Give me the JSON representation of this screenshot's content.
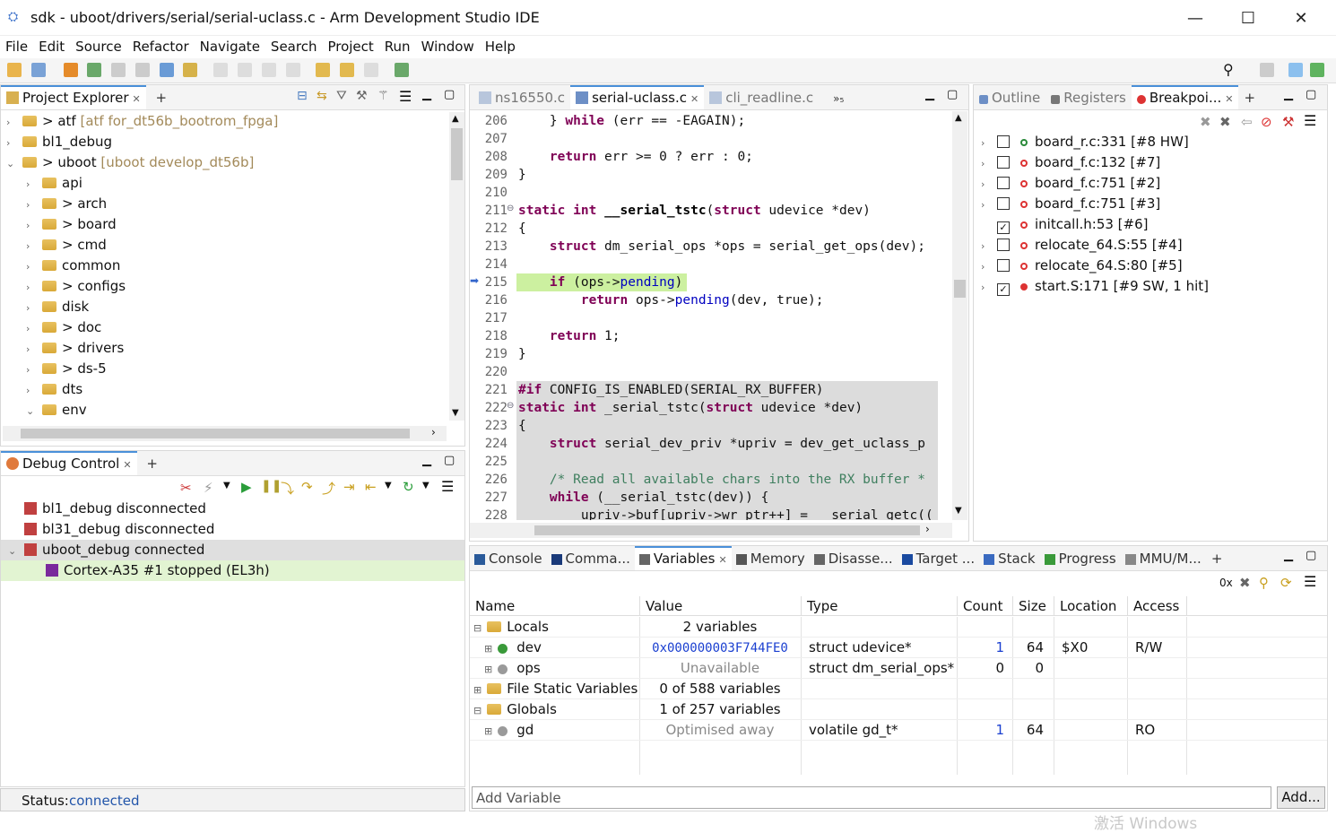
{
  "window": {
    "title": "sdk - uboot/drivers/serial/serial-uclass.c - Arm Development Studio IDE"
  },
  "menu": [
    "File",
    "Edit",
    "Source",
    "Refactor",
    "Navigate",
    "Search",
    "Project",
    "Run",
    "Window",
    "Help"
  ],
  "project_explorer": {
    "tab": "Project Explorer",
    "items": [
      {
        "label": "> atf",
        "extra": "[atf for_dt56b_bootrom_fpga]",
        "depth": 0,
        "expanded": false
      },
      {
        "label": "bl1_debug",
        "extra": "",
        "depth": 0,
        "expanded": false
      },
      {
        "label": "> uboot",
        "extra": "[uboot develop_dt56b]",
        "depth": 0,
        "expanded": true
      },
      {
        "label": "api",
        "extra": "",
        "depth": 1,
        "expanded": false
      },
      {
        "label": "> arch",
        "extra": "",
        "depth": 1,
        "expanded": false
      },
      {
        "label": "> board",
        "extra": "",
        "depth": 1,
        "expanded": false
      },
      {
        "label": "> cmd",
        "extra": "",
        "depth": 1,
        "expanded": false
      },
      {
        "label": "common",
        "extra": "",
        "depth": 1,
        "expanded": false
      },
      {
        "label": "> configs",
        "extra": "",
        "depth": 1,
        "expanded": false
      },
      {
        "label": "disk",
        "extra": "",
        "depth": 1,
        "expanded": false
      },
      {
        "label": "> doc",
        "extra": "",
        "depth": 1,
        "expanded": false
      },
      {
        "label": "> drivers",
        "extra": "",
        "depth": 1,
        "expanded": false
      },
      {
        "label": "> ds-5",
        "extra": "",
        "depth": 1,
        "expanded": false
      },
      {
        "label": "dts",
        "extra": "",
        "depth": 1,
        "expanded": false
      },
      {
        "label": "env",
        "extra": "",
        "depth": 1,
        "expanded": true
      }
    ]
  },
  "debug_control": {
    "tab": "Debug Control",
    "items": [
      {
        "label": "bl1_debug disconnected",
        "depth": 0
      },
      {
        "label": "bl31_debug disconnected",
        "depth": 0
      },
      {
        "label": "uboot_debug connected",
        "depth": 0
      },
      {
        "label": "Cortex-A35 #1 stopped (EL3h)",
        "depth": 1
      }
    ],
    "status_label": "Status:",
    "status_value": "connected"
  },
  "editor": {
    "tabs": [
      {
        "label": "ns16550.c",
        "active": false
      },
      {
        "label": "serial-uclass.c",
        "active": true
      },
      {
        "label": "cli_readline.c",
        "active": false
      }
    ],
    "overflow": "»₅",
    "lines": [
      {
        "n": "206",
        "html": "    } <span class='kw'>while</span> (err == -EAGAIN);"
      },
      {
        "n": "207",
        "html": ""
      },
      {
        "n": "208",
        "html": "    <span class='kw'>return</span> err >= 0 ? err : 0;"
      },
      {
        "n": "209",
        "html": "}"
      },
      {
        "n": "210",
        "html": ""
      },
      {
        "n": "211",
        "html": "<span class='kw'>static</span> <span class='kw'>int</span> <span class='fn'>__serial_tstc</span>(<span class='kw'>struct</span> udevice *dev)"
      },
      {
        "n": "212",
        "html": "{"
      },
      {
        "n": "213",
        "html": "    <span class='kw'>struct</span> dm_serial_ops *ops = serial_get_ops(dev);"
      },
      {
        "n": "214",
        "html": ""
      },
      {
        "n": "215",
        "html": "    <span class='kw'>if</span> (ops-><span class='mem'>pending</span>)"
      },
      {
        "n": "216",
        "html": "        <span class='kw'>return</span> ops-><span class='mem'>pending</span>(dev, true);"
      },
      {
        "n": "217",
        "html": ""
      },
      {
        "n": "218",
        "html": "    <span class='kw'>return</span> 1;"
      },
      {
        "n": "219",
        "html": "}"
      },
      {
        "n": "220",
        "html": ""
      },
      {
        "n": "221",
        "html": "<span class='kw'>#if</span> CONFIG_IS_ENABLED(SERIAL_RX_BUFFER)"
      },
      {
        "n": "222",
        "html": "<span class='kw'>static</span> <span class='kw'>int</span> _serial_tstc(<span class='kw'>struct</span> udevice *dev)"
      },
      {
        "n": "223",
        "html": "{"
      },
      {
        "n": "224",
        "html": "    <span class='kw'>struct</span> serial_dev_priv *upriv = dev_get_uclass_p"
      },
      {
        "n": "225",
        "html": ""
      },
      {
        "n": "226",
        "html": "    <span class='cm'>/* Read all available chars into the RX buffer *</span>"
      },
      {
        "n": "227",
        "html": "    <span class='kw'>while</span> (__serial_tstc(dev)) {"
      },
      {
        "n": "228",
        "html": "        upriv->buf[upriv->wr_ptr++] = __serial_getc(("
      }
    ]
  },
  "right_panel": {
    "tabs": [
      {
        "label": "Outline",
        "active": false
      },
      {
        "label": "Registers",
        "active": false
      },
      {
        "label": "Breakpoi...",
        "active": true
      }
    ],
    "breakpoints": [
      {
        "label": "board_r.c:331 [#8 HW]",
        "checked": false,
        "expand": true
      },
      {
        "label": "board_f.c:132 [#7]",
        "checked": false,
        "expand": true
      },
      {
        "label": "board_f.c:751 [#2]",
        "checked": false,
        "expand": true
      },
      {
        "label": "board_f.c:751 [#3]",
        "checked": false,
        "expand": true
      },
      {
        "label": "initcall.h:53 [#6]",
        "checked": true,
        "expand": false
      },
      {
        "label": "relocate_64.S:55 [#4]",
        "checked": false,
        "expand": true
      },
      {
        "label": "relocate_64.S:80 [#5]",
        "checked": false,
        "expand": true
      },
      {
        "label": "start.S:171 [#9 SW, 1 hit]",
        "checked": true,
        "expand": true
      }
    ]
  },
  "bottom": {
    "tabs": [
      {
        "label": "Console",
        "active": false
      },
      {
        "label": "Comma...",
        "active": false
      },
      {
        "label": "Variables",
        "active": true
      },
      {
        "label": "Memory",
        "active": false
      },
      {
        "label": "Disasse...",
        "active": false
      },
      {
        "label": "Target ...",
        "active": false
      },
      {
        "label": "Stack",
        "active": false
      },
      {
        "label": "Progress",
        "active": false
      },
      {
        "label": "MMU/M...",
        "active": false
      }
    ],
    "hex_label": "0x",
    "columns": [
      "Name",
      "Value",
      "Type",
      "Count",
      "Size",
      "Location",
      "Access"
    ],
    "rows": [
      {
        "name": "Locals",
        "value": "2 variables",
        "type": "",
        "count": "",
        "size": "",
        "loc": "",
        "access": "",
        "level": 0,
        "folder": true
      },
      {
        "name": "dev",
        "value": "0x000000003F744FE0",
        "type": "struct udevice*",
        "count": "1",
        "size": "64",
        "loc": "$X0",
        "access": "R/W",
        "level": 1,
        "folder": false
      },
      {
        "name": "ops",
        "value": "Unavailable",
        "type": "struct dm_serial_ops*",
        "count": "0",
        "size": "0",
        "loc": "",
        "access": "",
        "level": 1,
        "folder": false
      },
      {
        "name": "File Static Variables",
        "value": "0 of 588 variables",
        "type": "",
        "count": "",
        "size": "",
        "loc": "",
        "access": "",
        "level": 0,
        "folder": true
      },
      {
        "name": "Globals",
        "value": "1 of 257 variables",
        "type": "",
        "count": "",
        "size": "",
        "loc": "",
        "access": "",
        "level": 0,
        "folder": true
      },
      {
        "name": "gd",
        "value": "Optimised away",
        "type": "volatile gd_t*",
        "count": "1",
        "size": "64",
        "loc": "",
        "access": "RO",
        "level": 1,
        "folder": false
      }
    ],
    "add_variable_placeholder": "Add Variable",
    "add_button": "Add..."
  },
  "watermark": "激活 Windows",
  "colors": {
    "accent": "#4a90d9",
    "pc_highlight": "#ccf0a0",
    "selected_row": "#dfe7f3",
    "debug_selected": "#e2f4d2"
  }
}
